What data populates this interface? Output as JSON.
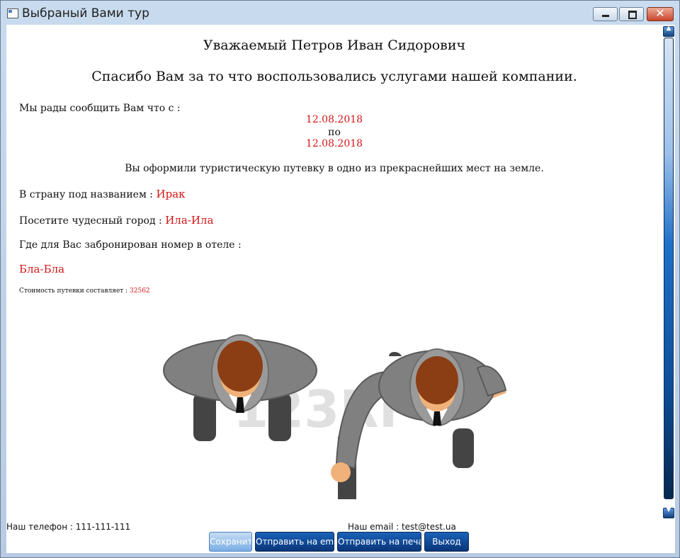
{
  "window": {
    "title": "Выбраный Вами тур"
  },
  "letter": {
    "greeting": "Уважаемый Петров Иван Сидорович",
    "thanks": "Спасибо Вам за то что воспользовались услугами нашей компании.",
    "intro": "Мы рады сообщить Вам что с :",
    "date_from": "12.08.2018",
    "date_sep": "по",
    "date_to": "12.08.2018",
    "booked": "Вы оформили туристическую путевку в одно из прекраснейших мест на земле.",
    "country_label": "В страну под названием :",
    "country_value": "Ирак",
    "city_label": "Посетите чудесный город :",
    "city_value": "Ила-Ила",
    "hotel_label": "Где для Вас забронирован номер в отеле :",
    "hotel_value": "Бла-Бла",
    "cost_label": "Стоимость путевки составляет :",
    "cost_value": "32562"
  },
  "image": {
    "watermark": "123RF"
  },
  "footer": {
    "phone": "Наш телефон : 111-111-111",
    "email": "Наш email : test@test.ua"
  },
  "buttons": {
    "save": "Сохранить",
    "send_email": "Отправить на email",
    "print": "Отправить на печать",
    "exit": "Выход"
  },
  "colors": {
    "highlight": "#d41515",
    "button": "#0a3578"
  }
}
